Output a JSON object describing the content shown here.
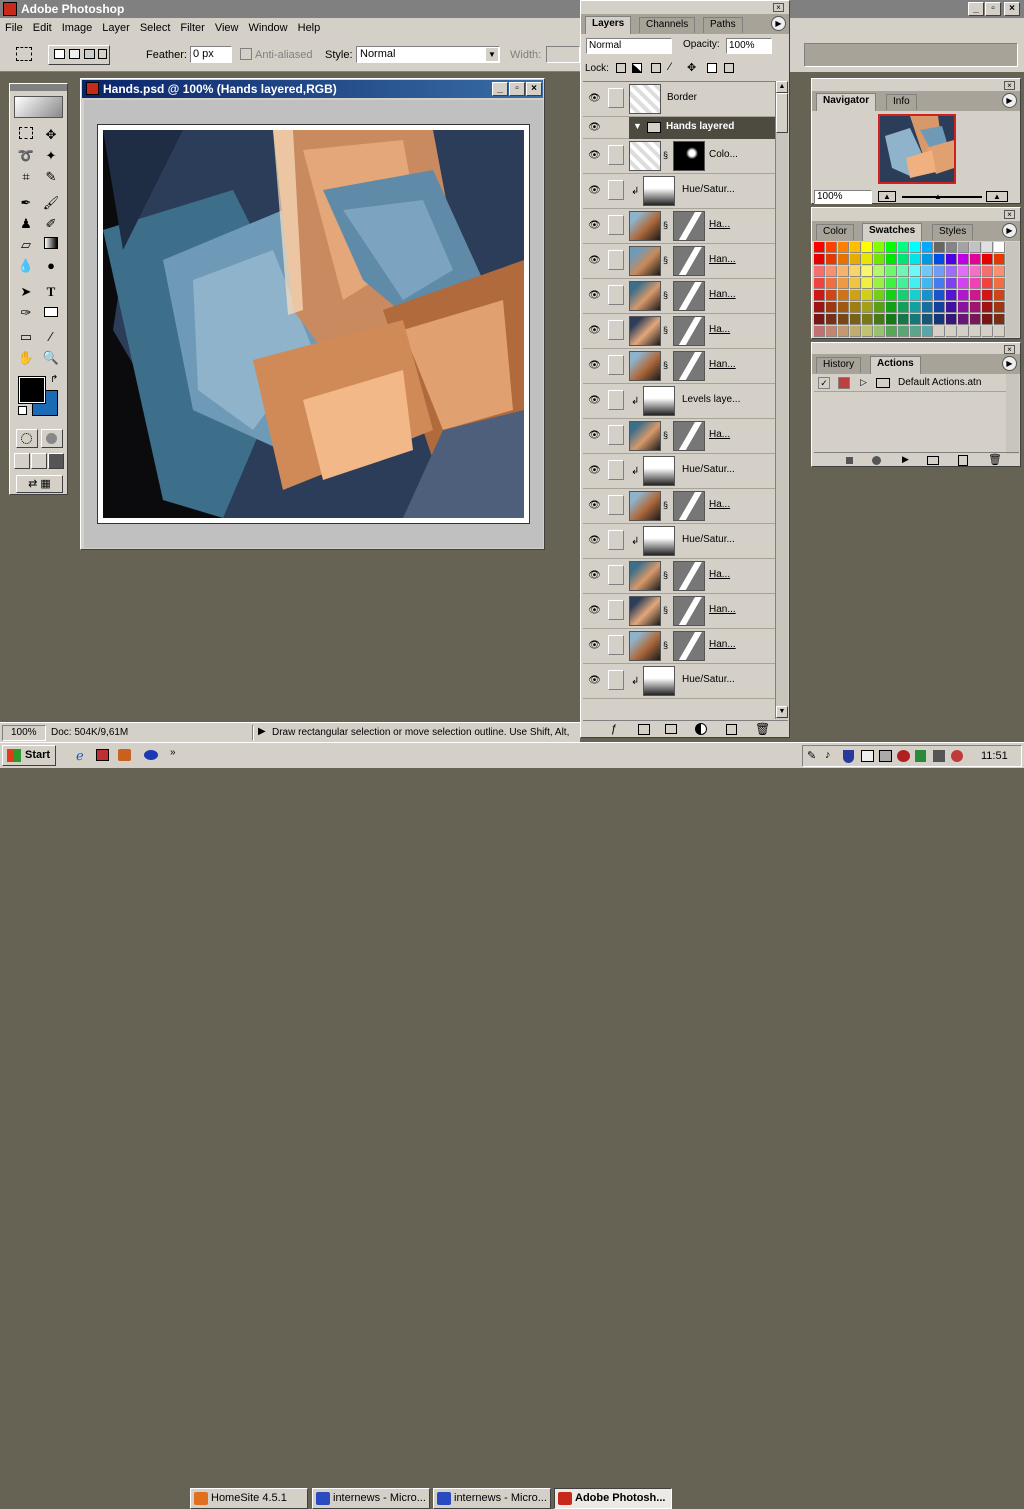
{
  "app": {
    "title": "Adobe Photoshop"
  },
  "menu": [
    "File",
    "Edit",
    "Image",
    "Layer",
    "Select",
    "Filter",
    "View",
    "Window",
    "Help"
  ],
  "options_bar": {
    "feather_label": "Feather:",
    "feather_value": "0 px",
    "antialiased_label": "Anti-aliased",
    "style_label": "Style:",
    "style_value": "Normal",
    "width_label": "Width:"
  },
  "document": {
    "title": "Hands.psd @ 100% (Hands layered,RGB)"
  },
  "layers_panel": {
    "tabs": [
      "Layers",
      "Channels",
      "Paths"
    ],
    "blend_mode": "Normal",
    "opacity_label": "Opacity:",
    "opacity_value": "100%",
    "lock_label": "Lock:",
    "group_name": "Hands layered",
    "layers": [
      {
        "name": "Border",
        "kind": "plain"
      },
      {
        "name": "Colo...",
        "kind": "fill"
      },
      {
        "name": "Hue/Satur...",
        "kind": "adjust"
      },
      {
        "name": "Ha...",
        "kind": "hand"
      },
      {
        "name": "Han...",
        "kind": "hand"
      },
      {
        "name": "Han...",
        "kind": "hand"
      },
      {
        "name": "Ha...",
        "kind": "hand"
      },
      {
        "name": "Han...",
        "kind": "hand"
      },
      {
        "name": "Levels laye...",
        "kind": "adjust"
      },
      {
        "name": "Ha...",
        "kind": "hand"
      },
      {
        "name": "Hue/Satur...",
        "kind": "adjust"
      },
      {
        "name": "Ha...",
        "kind": "hand"
      },
      {
        "name": "Hue/Satur...",
        "kind": "adjust"
      },
      {
        "name": "Ha...",
        "kind": "hand"
      },
      {
        "name": "Han...",
        "kind": "hand"
      },
      {
        "name": "Han...",
        "kind": "hand"
      },
      {
        "name": "Hue/Satur...",
        "kind": "adjust"
      }
    ]
  },
  "navigator": {
    "tabs": [
      "Navigator",
      "Info"
    ],
    "zoom": "100%"
  },
  "color_panel": {
    "tabs": [
      "Color",
      "Swatches",
      "Styles"
    ]
  },
  "actions_panel": {
    "tabs": [
      "History",
      "Actions"
    ],
    "set_name": "Default Actions.atn"
  },
  "status_bar": {
    "zoom": "100%",
    "doc_size": "Doc: 504K/9,61M",
    "hint": "Draw rectangular selection or move selection outline.  Use Shift, Alt,"
  },
  "taskbar": {
    "start": "Start",
    "items": [
      "HomeSite 4.5.1",
      "internews - Micro...",
      "internews - Micro...",
      "Adobe Photosh..."
    ],
    "clock": "11:51"
  },
  "colors": {
    "workspace": "#666354",
    "foreground": "#000000",
    "background_swatch": "#1a6ab4"
  }
}
